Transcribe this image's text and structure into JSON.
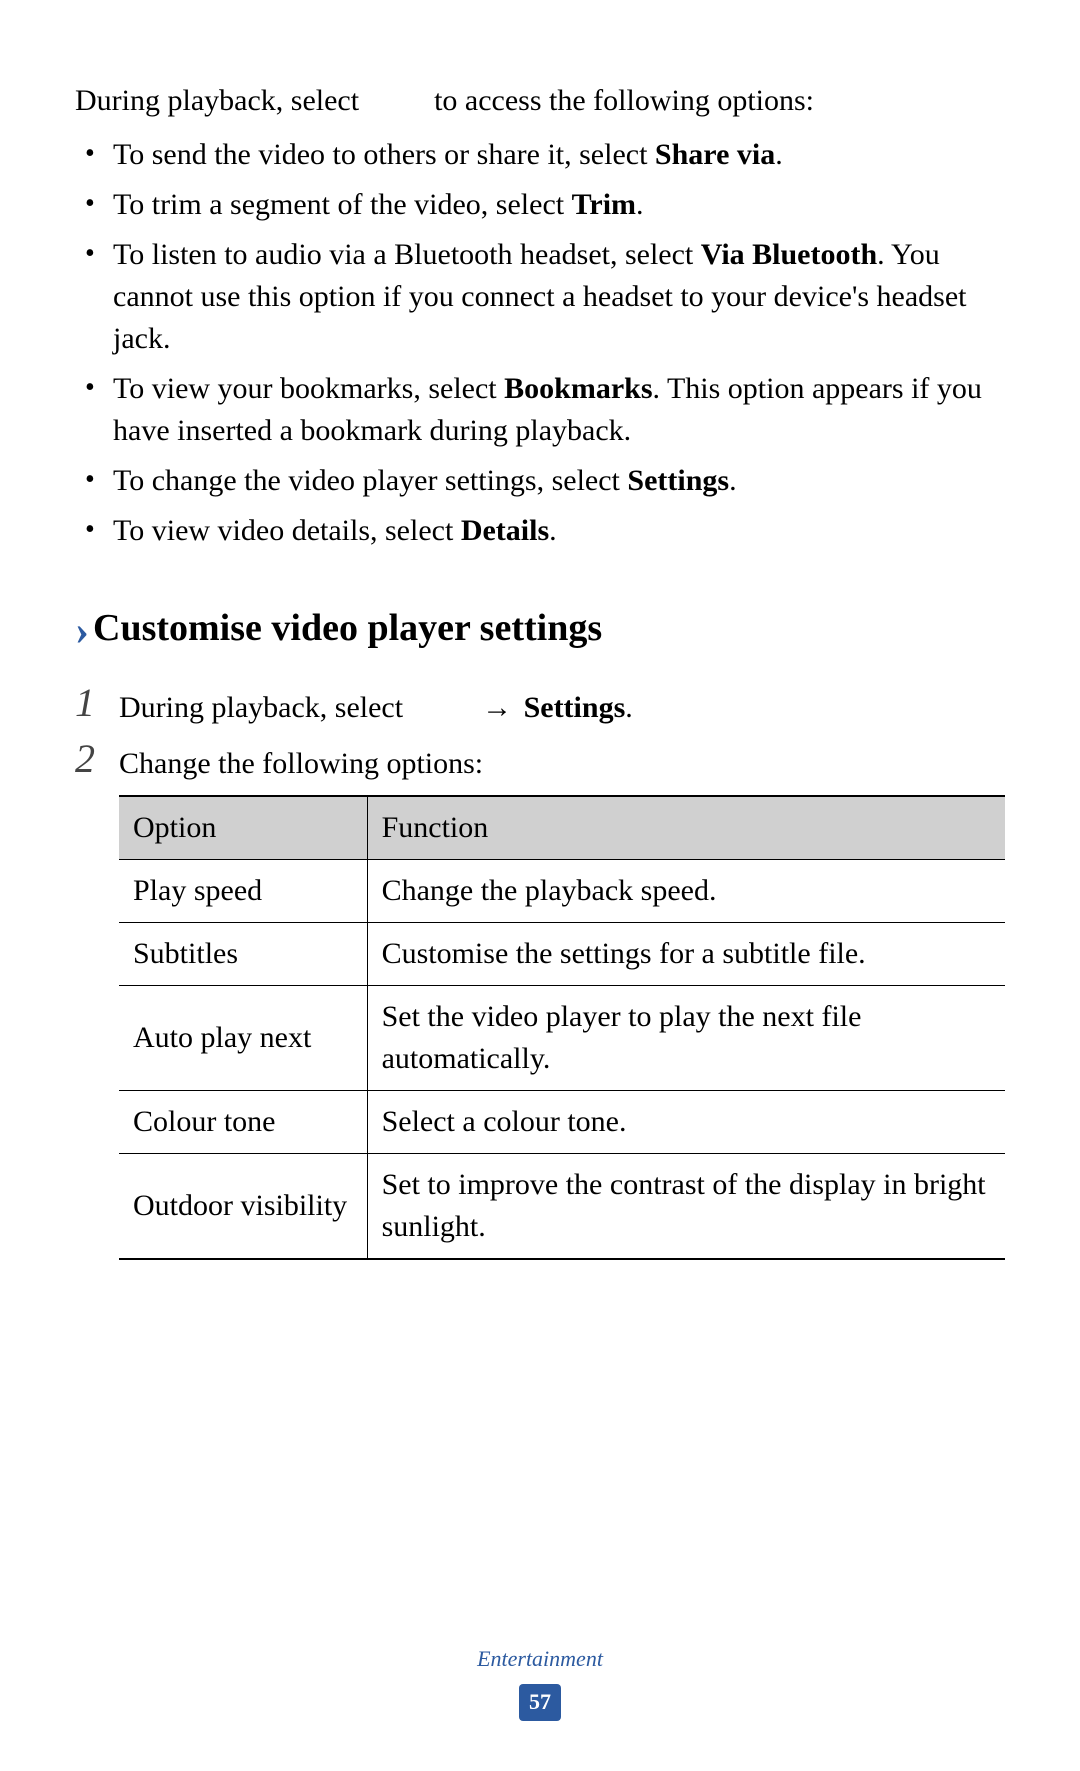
{
  "intro": {
    "prefix": "During playback, select",
    "suffix": "to access the following options:"
  },
  "bullets": {
    "b0": {
      "pre": "To send the video to others or share it, select ",
      "bold": "Share via",
      "post": "."
    },
    "b1": {
      "pre": "To trim a segment of the video, select ",
      "bold": "Trim",
      "post": "."
    },
    "b2": {
      "pre": "To listen to audio via a Bluetooth headset, select ",
      "bold1": "Via Bluetooth",
      "post": ". You cannot use this option if you connect a headset to your device's headset jack."
    },
    "b3": {
      "pre": "To view your bookmarks, select ",
      "bold": "Bookmarks",
      "post": ". This option appears if you have inserted a bookmark during playback."
    },
    "b4": {
      "pre": "To change the video player settings, select ",
      "bold": "Settings",
      "post": "."
    },
    "b5": {
      "pre": "To view video details, select ",
      "bold": "Details",
      "post": "."
    }
  },
  "section": {
    "chevron": "›",
    "title": "Customise video player settings"
  },
  "steps": {
    "s1": {
      "num": "1",
      "pre": "During playback, select ",
      "arrow": "→",
      "bold": "Settings",
      "post": "."
    },
    "s2": {
      "num": "2",
      "text": "Change the following options:"
    }
  },
  "table": {
    "head": {
      "option": "Option",
      "func": "Function"
    },
    "rows": {
      "r0": {
        "opt": "Play speed",
        "fn": "Change the playback speed."
      },
      "r1": {
        "opt": "Subtitles",
        "fn": "Customise the settings for a subtitle file."
      },
      "r2": {
        "opt": "Auto play next",
        "fn": "Set the video player to play the next file automatically."
      },
      "r3": {
        "opt": "Colour tone",
        "fn": "Select a colour tone."
      },
      "r4": {
        "opt": "Outdoor visibility",
        "fn": "Set to improve the contrast of the display in bright sunlight."
      }
    }
  },
  "footer": {
    "section": "Entertainment",
    "page": "57"
  }
}
